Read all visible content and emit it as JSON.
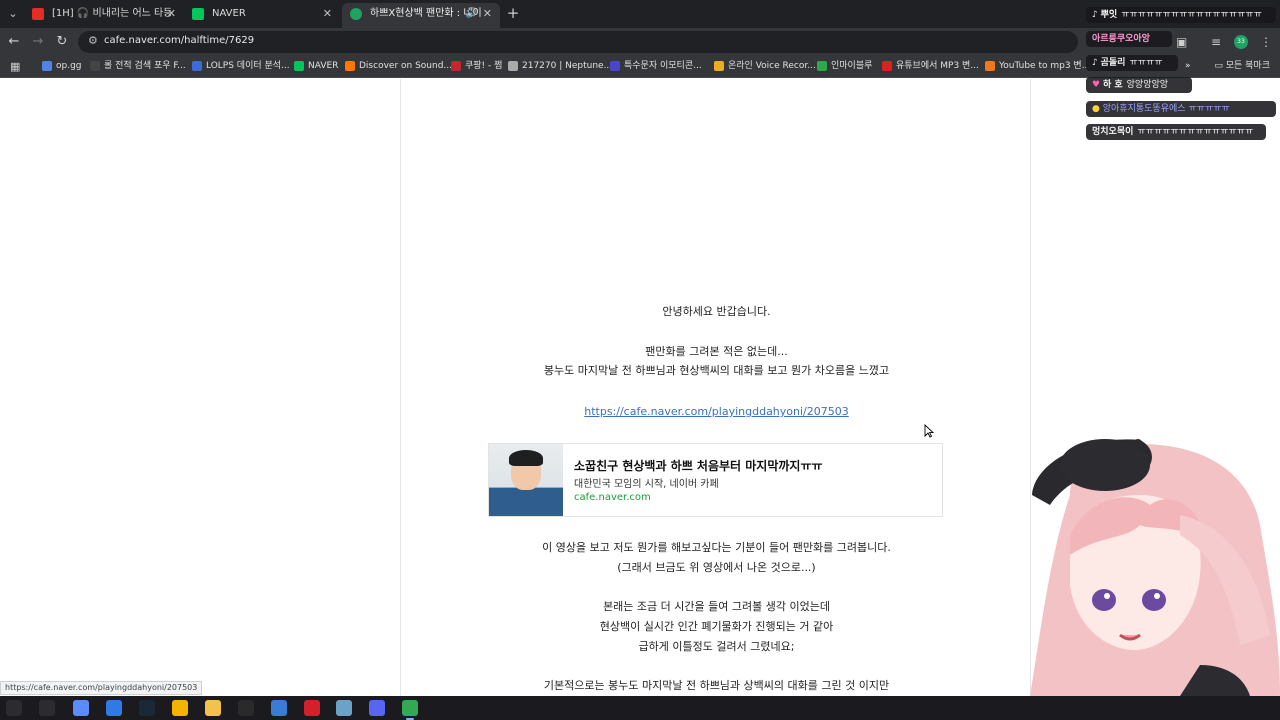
{
  "browser": {
    "tabs": [
      {
        "title": "[1H] 🎧 비내리는 어느 타등",
        "favicon": "youtube-icon",
        "active": false,
        "audio": false
      },
      {
        "title": "NAVER",
        "favicon": "naver-icon",
        "active": false,
        "audio": false
      },
      {
        "title": "하쁘X현상백 팬만화 : 네이",
        "favicon": "cafe-icon",
        "active": true,
        "audio": true
      }
    ],
    "new_tab": "+",
    "url": "cafe.naver.com/halftime/7629",
    "bookmarks": [
      {
        "label": "op.gg",
        "color": "#5383e8"
      },
      {
        "label": "롤 전적 검색 포우 F...",
        "color": "#444444"
      },
      {
        "label": "LOLPS 데이터 분석...",
        "color": "#3b6bd6"
      },
      {
        "label": "NAVER",
        "color": "#03c75a"
      },
      {
        "label": "Discover on Sound...",
        "color": "#ff7700"
      },
      {
        "label": "쿠팡! - 쩜",
        "color": "#c4262e"
      },
      {
        "label": "217270 | Neptune...",
        "color": "#aaaaaa"
      },
      {
        "label": "특수문자 이모티콘...",
        "color": "#4a46c8"
      },
      {
        "label": "온라인 Voice Recor...",
        "color": "#e8b020"
      },
      {
        "label": "인마이블루",
        "color": "#2ea84a"
      },
      {
        "label": "유튜브에서 MP3 변...",
        "color": "#e02020"
      },
      {
        "label": "YouTube to mp3 변...",
        "color": "#f07a1a"
      }
    ],
    "all_bookmarks": "모든 북마크",
    "profile_initials": "33"
  },
  "article": {
    "greeting": "안녕하세요 반갑습니다.",
    "p2_line1": "팬만화를 그려본 적은 없는데...",
    "p2_line2": "봉누도 마지막날 전 하쁘님과 현상백씨의 대화를 보고 뭔가 차오름을 느꼈고",
    "link": "https://cafe.naver.com/playingddahyoni/207503",
    "card": {
      "title": "소꿉친구 현상백과 하쁘 처음부터 마지막까지ㅠㅠ",
      "description": "대한민국 모임의 시작, 네이버 카페",
      "domain": "cafe.naver.com"
    },
    "p3_line1": "이 영상을 보고 저도 뭔가를 해보고싶다는 기분이 들어 팬만화를 그려봅니다.",
    "p3_line2": "(그래서 브금도 위 영상에서 나온 것으로...)",
    "p4_line1": "본래는 조금 더 시간을 들여 그려볼 생각 이었는데",
    "p4_line2": "현상백이 실시간 인간 폐기물화가 진행되는 거 같아",
    "p4_line3": "급하게 이틀정도 걸려서 그렸네요;",
    "p5_line1": "기본적으로는 봉누도 마지막날 전 하쁘님과 상백씨의 대화를 그린 것 이지만"
  },
  "status_bar_url": "https://cafe.naver.com/playingddahyoni/207503",
  "chat": [
    {
      "nick": "뿌잇",
      "text": "ㅠㅠㅠㅠㅠㅠㅠㅠㅠㅠㅠㅠㅠㅠㅠㅠㅠ",
      "color": "#ffffff"
    },
    {
      "nick": "아르릉쿠오아앙",
      "text": "",
      "color": "#ff9bd2"
    },
    {
      "nick": "곰돌리",
      "text": "ㅠㅠㅠㅠ",
      "color": "#ffffff"
    },
    {
      "nick": "하 호",
      "text": "앙앙앙앙앙",
      "color": "#ffd6f0"
    },
    {
      "nick": "",
      "text": "앙아휴지통도똥유에스 ㅠㅠㅠㅠㅠ",
      "color": "#9aa4ff"
    },
    {
      "nick": "멍치오목이",
      "text": "ㅠㅠㅠㅠㅠㅠㅠㅠㅠㅠㅠㅠㅠㅠ",
      "color": "#ffffff"
    }
  ],
  "taskbar_apps": [
    {
      "name": "start-icon",
      "color": "#2b2b30"
    },
    {
      "name": "task-view-icon",
      "color": "#2b2b30"
    },
    {
      "name": "copilot-icon",
      "color": "#5b8cff"
    },
    {
      "name": "app-blue-icon",
      "color": "#2f7ae5"
    },
    {
      "name": "steam-icon",
      "color": "#1b2838"
    },
    {
      "name": "chrome-icon",
      "color": "#f4b400"
    },
    {
      "name": "file-explorer-icon",
      "color": "#f2c14e"
    },
    {
      "name": "epic-games-icon",
      "color": "#2a2a2a"
    },
    {
      "name": "app-window-icon",
      "color": "#3a7bd5"
    },
    {
      "name": "opera-icon",
      "color": "#d3202a"
    },
    {
      "name": "vegas-icon",
      "color": "#6aa3c8"
    },
    {
      "name": "discord-icon",
      "color": "#5865f2"
    },
    {
      "name": "chrome-active-icon",
      "color": "#34a853"
    }
  ]
}
